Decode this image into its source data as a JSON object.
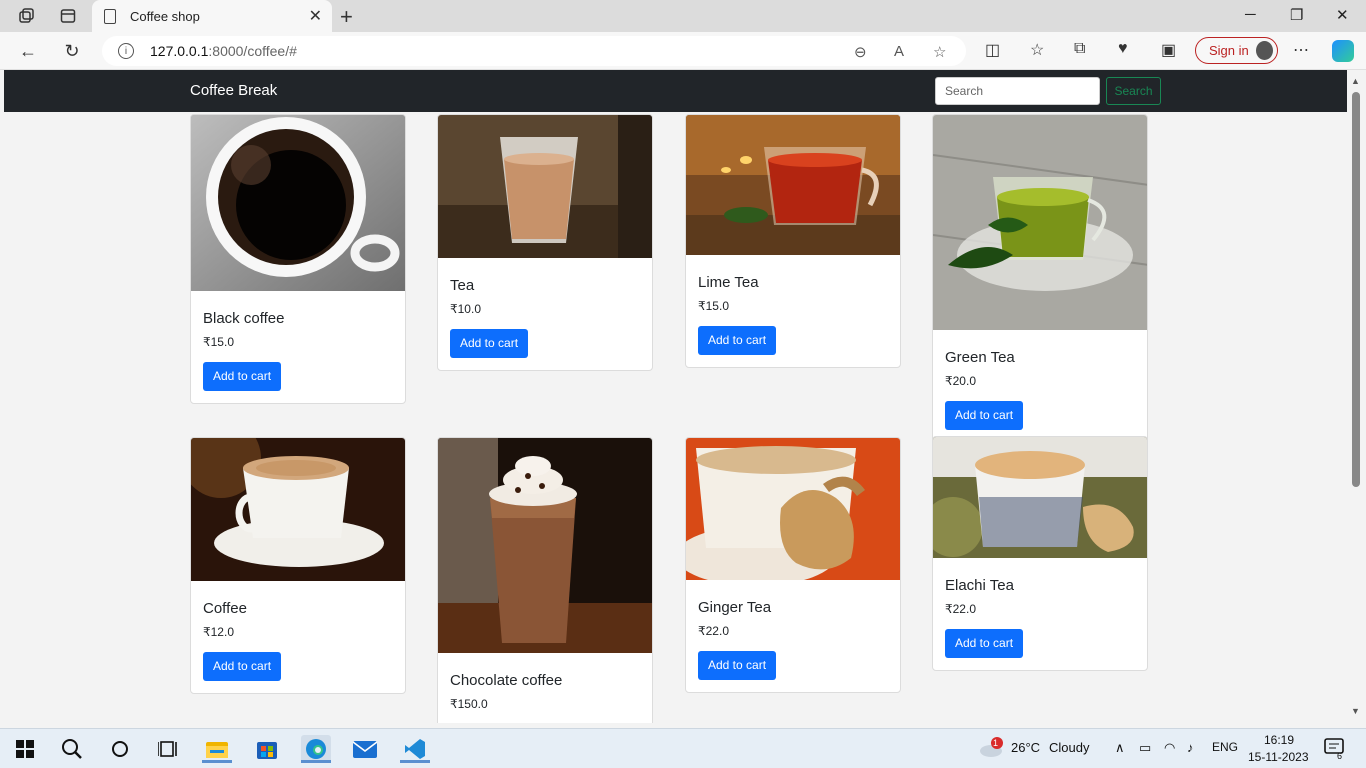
{
  "browser": {
    "tab_title": "Coffee shop",
    "url_host": "127.0.0.1",
    "url_path": ":8000/coffee/#",
    "signin_label": "Sign in"
  },
  "app": {
    "brand": "Coffee Break",
    "search_placeholder": "Search",
    "search_button": "Search",
    "add_label": "Add to cart"
  },
  "products": [
    {
      "name": "Black coffee",
      "price": "₹15.0",
      "image": "black-coffee-image"
    },
    {
      "name": "Tea",
      "price": "₹10.0",
      "image": "tea-image"
    },
    {
      "name": "Lime Tea",
      "price": "₹15.0",
      "image": "lime-tea-image"
    },
    {
      "name": "Green Tea",
      "price": "₹20.0",
      "image": "green-tea-image"
    },
    {
      "name": "Coffee",
      "price": "₹12.0",
      "image": "coffee-image"
    },
    {
      "name": "Chocolate coffee",
      "price": "₹150.0",
      "image": "chocolate-coffee-image"
    },
    {
      "name": "Ginger Tea",
      "price": "₹22.0",
      "image": "ginger-tea-image"
    },
    {
      "name": "Elachi Tea",
      "price": "₹22.0",
      "image": "elachi-tea-image"
    }
  ],
  "taskbar": {
    "weather_temp": "26°C",
    "weather_text": "Cloudy",
    "weather_badge": "1",
    "lang": "ENG",
    "time": "16:19",
    "date": "15-11-2023",
    "notif_count": "6"
  },
  "colors": {
    "navbar": "#212529",
    "primary": "#0d6efd",
    "success": "#198754"
  }
}
